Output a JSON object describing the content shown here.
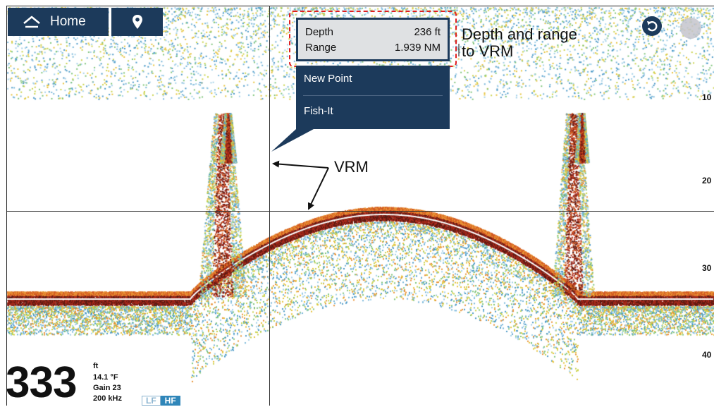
{
  "toolbar": {
    "home_label": "Home",
    "home_icon": "home-icon",
    "waypoint_icon": "map-pin-icon",
    "undo_icon": "undo-icon",
    "settings_icon": "gear-icon"
  },
  "vrm_readout": {
    "depth_label": "Depth",
    "depth_value": "236 ft",
    "range_label": "Range",
    "range_value": "1.939 NM"
  },
  "context_menu": {
    "items": [
      {
        "label": "New Point"
      },
      {
        "label": "Fish-It"
      }
    ]
  },
  "annotations": {
    "depth_range_line1": "Depth and range",
    "depth_range_line2": "to VRM",
    "vrm_label": "VRM"
  },
  "depth_scale": {
    "ticks": [
      "10",
      "20",
      "30",
      "40"
    ]
  },
  "status": {
    "depth": "333",
    "unit": "ft",
    "temperature": "14.1 °F",
    "gain": "Gain 23",
    "frequency": "200 kHz",
    "lf_label": "LF",
    "hf_label": "HF",
    "active_band": "HF"
  },
  "colors": {
    "panel": "#1c3a5b",
    "highlight": "#e02020",
    "hf_active": "#2f86b9"
  }
}
